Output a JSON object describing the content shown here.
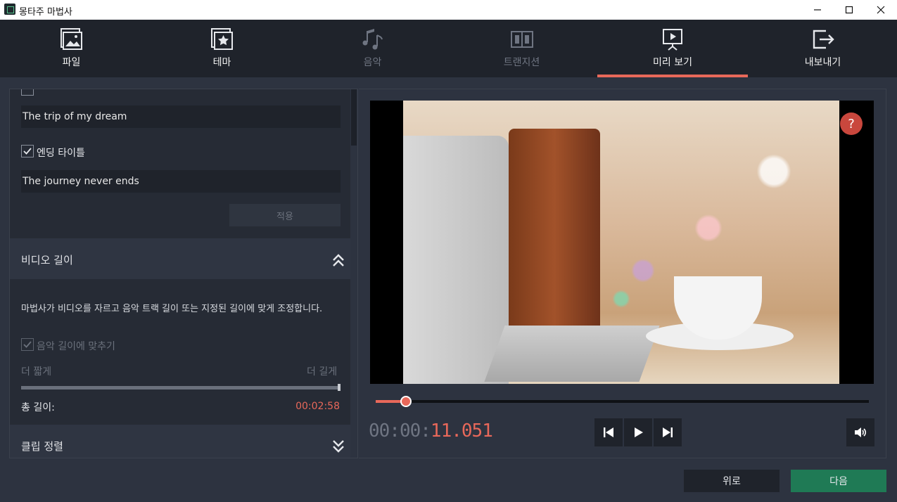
{
  "window": {
    "title": "몽타주 마법사"
  },
  "toolbar": {
    "tabs": [
      {
        "label": "파일"
      },
      {
        "label": "테마"
      },
      {
        "label": "음악"
      },
      {
        "label": "트랜지션"
      },
      {
        "label": "미리 보기"
      },
      {
        "label": "내보내기"
      }
    ],
    "active_tab": "미리 보기",
    "accent_color": "#e8685a"
  },
  "left": {
    "opening_title_value": "The trip of my dream",
    "ending_title_label": "엔딩 타이틀",
    "ending_title_value": "The journey never ends",
    "apply_label": "적용",
    "video_length": {
      "heading": "비디오 길이",
      "description": "마법사가 비디오를 자르고 음악 트랙 길이 또는 지정된 길이에 맞게 조정합니다.",
      "fit_music_label": "음악 길이에 맞추기",
      "shorter_label": "더 짧게",
      "longer_label": "더 길게",
      "total_label": "총 길이:",
      "total_value": "00:02:58"
    },
    "clip_sort_heading": "클립 정렬"
  },
  "preview": {
    "help_symbol": "?",
    "timecode_dim": "00:00:",
    "timecode_active": "11.051",
    "seek_progress": 0.061
  },
  "footer": {
    "back_label": "위로",
    "next_label": "다음",
    "next_color": "#1f7a55",
    "back_color": "#1f232b"
  }
}
